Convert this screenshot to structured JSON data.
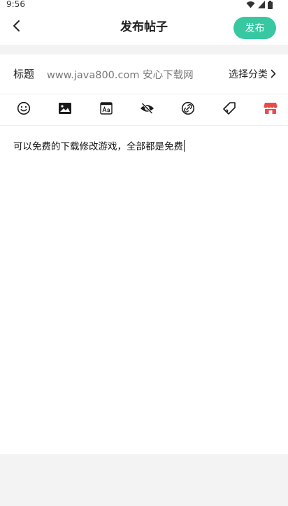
{
  "status_bar": {
    "time": "9:56",
    "icons": [
      "wifi-icon",
      "signal-icon",
      "battery-icon"
    ]
  },
  "header": {
    "title": "发布帖子",
    "publish_label": "发布",
    "back_icon": "chevron-left-icon"
  },
  "title_row": {
    "label": "标题",
    "value": "www.java800.com 安心下载网",
    "category_label": "选择分类",
    "category_icon": "chevron-right-icon"
  },
  "toolbar": {
    "tools": [
      "emoji-icon",
      "image-icon",
      "text-format-icon",
      "hidden-content-icon",
      "link-icon",
      "tag-icon",
      "shop-icon"
    ]
  },
  "editor": {
    "content": "可以免费的下载修改游戏，全部都是免费"
  },
  "colors": {
    "accent": "#38c8a1",
    "shop_icon": "#e94b4b",
    "background_band": "#f3f3f3"
  }
}
